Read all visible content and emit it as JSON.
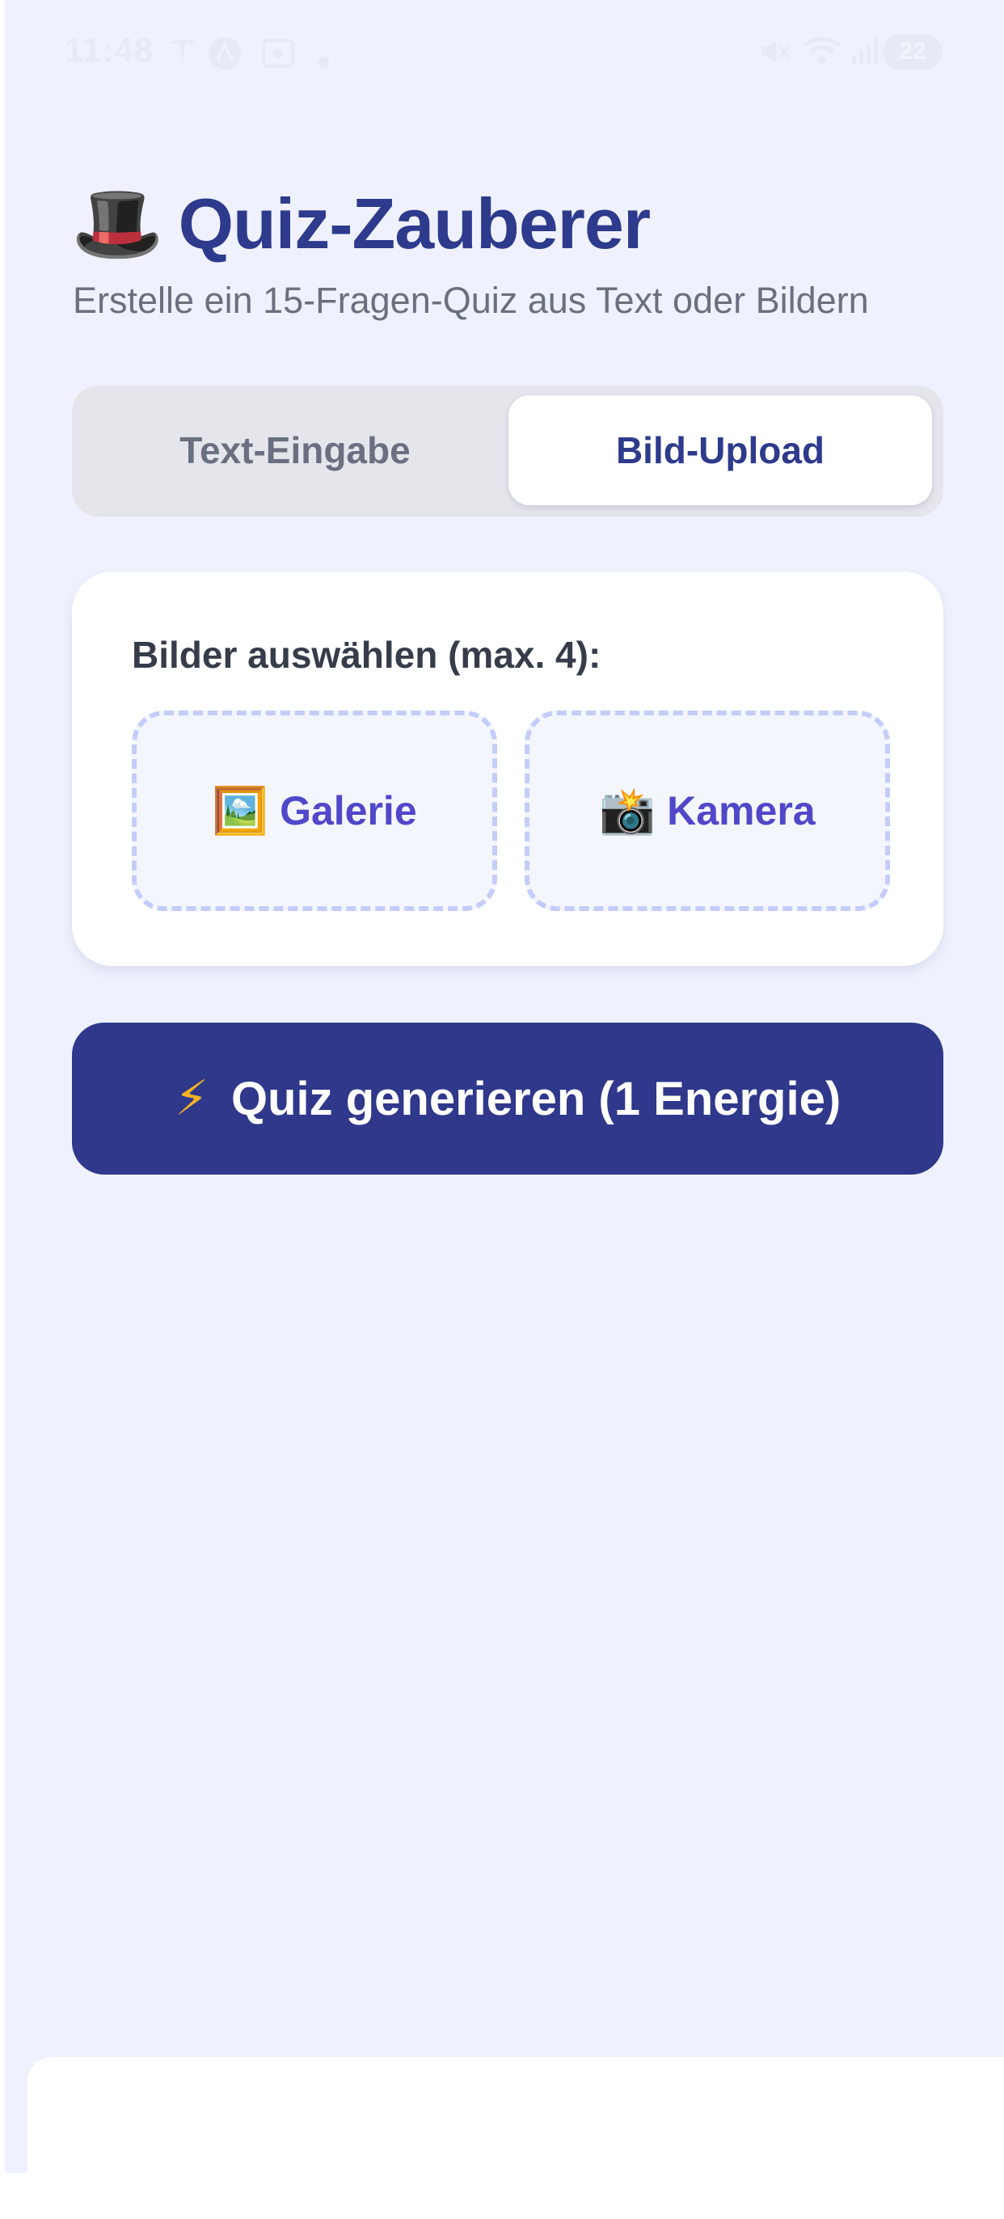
{
  "status_bar": {
    "time": "11:48",
    "battery": "22",
    "icons": [
      "tesla-icon",
      "a-circle-icon",
      "screen-record-icon",
      "notification-dot-icon",
      "mute-icon",
      "wifi-icon",
      "signal-icon",
      "battery-icon"
    ]
  },
  "header": {
    "emoji": "🎩",
    "title": "Quiz-Zauberer",
    "subtitle": "Erstelle ein 15-Fragen-Quiz aus Text oder Bildern"
  },
  "tabs": {
    "items": [
      {
        "label": "Text-Eingabe",
        "selected": false
      },
      {
        "label": "Bild-Upload",
        "selected": true
      }
    ]
  },
  "upload_card": {
    "label": "Bilder auswählen (max. 4):",
    "gallery": {
      "icon": "🖼️",
      "label": "Galerie"
    },
    "camera": {
      "icon": "📸",
      "label": "Kamera"
    }
  },
  "generate_button": {
    "icon": "⚡",
    "label": "Quiz generieren (1 Energie)"
  },
  "colors": {
    "background": "#eff2fe",
    "title": "#2e3a8c",
    "accent": "#5047c9",
    "primary_button": "#2f388b",
    "dashed_border": "#c4cdfa"
  }
}
